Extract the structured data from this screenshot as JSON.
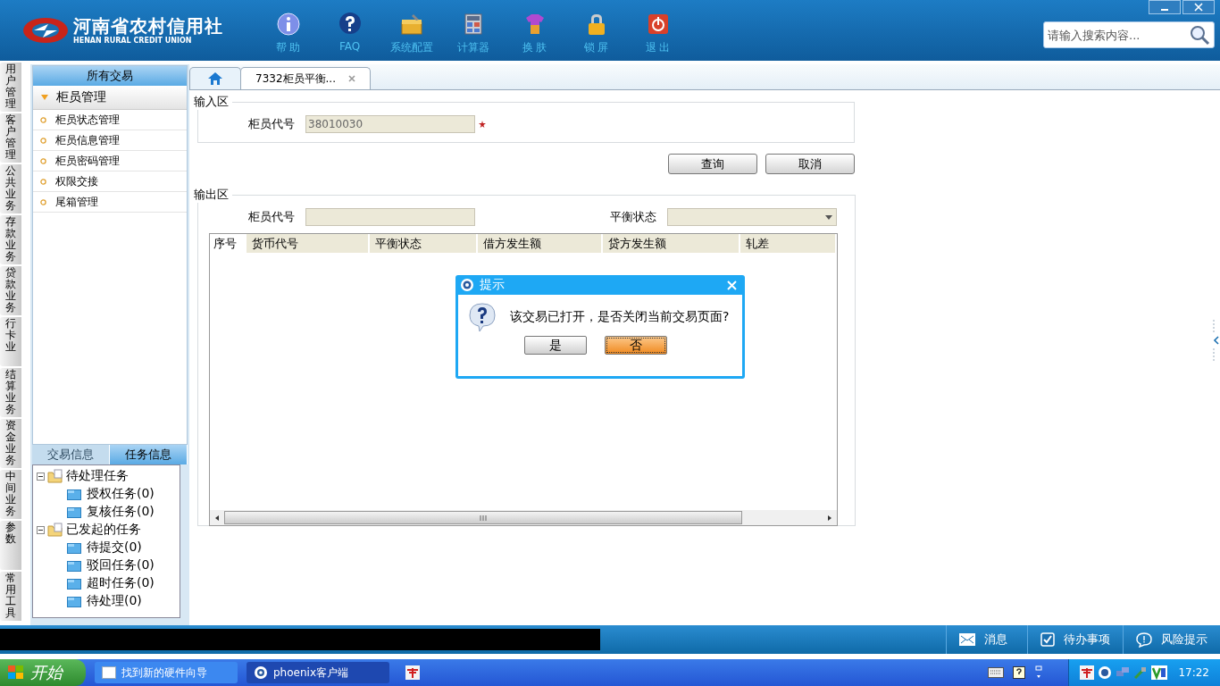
{
  "header": {
    "logo_title": "河南省农村信用社",
    "logo_subtitle": "HENAN RURAL CREDIT UNION",
    "toolbar": [
      {
        "label": "帮 助",
        "kind": "help"
      },
      {
        "label": "FAQ",
        "kind": "faq"
      },
      {
        "label": "系统配置",
        "kind": "config"
      },
      {
        "label": "计算器",
        "kind": "calculator"
      },
      {
        "label": "换 肤",
        "kind": "skin"
      },
      {
        "label": "锁 屏",
        "kind": "lock"
      },
      {
        "label": "退 出",
        "kind": "exit"
      }
    ],
    "search": {
      "placeholder": "请输入搜索内容..."
    }
  },
  "side_tabs": [
    "用户管理",
    "客户管理",
    "公共业务",
    "存款业务",
    "贷款业务",
    "行卡业",
    "结算业务",
    "资金业务",
    "中间业务",
    "参数",
    "常用工具"
  ],
  "menu": {
    "title": "所有交易",
    "group": "柜员管理",
    "expanded": true,
    "items": [
      "柜员状态管理",
      "柜员信息管理",
      "柜员密码管理",
      "权限交接",
      "尾箱管理"
    ]
  },
  "task_panel": {
    "tabs": [
      {
        "label": "交易信息",
        "selected": false
      },
      {
        "label": "任务信息",
        "selected": true
      }
    ],
    "tree": [
      {
        "label": "待处理任务",
        "expanded": true,
        "children": [
          {
            "label": "授权任务(0)"
          },
          {
            "label": "复核任务(0)"
          }
        ]
      },
      {
        "label": "已发起的任务",
        "expanded": true,
        "children": [
          {
            "label": "待提交(0)"
          },
          {
            "label": "驳回任务(0)"
          },
          {
            "label": "超时任务(0)"
          },
          {
            "label": "待处理(0)"
          }
        ]
      }
    ]
  },
  "tabs": [
    {
      "kind": "home",
      "selected": false
    },
    {
      "kind": "page",
      "label": "7332柜员平衡...",
      "selected": true
    }
  ],
  "input_section": {
    "title": "输入区",
    "label": "柜员代号",
    "value": "38010030",
    "required": true
  },
  "buttons": [
    "查询",
    "取消"
  ],
  "output_section": {
    "title": "输出区",
    "fields": [
      {
        "label": "柜员代号",
        "kind": "text"
      },
      {
        "label": "平衡状态",
        "kind": "select"
      }
    ],
    "columns": [
      "序号",
      "货币代号",
      "平衡状态",
      "借方发生额",
      "贷方发生额",
      "轧差"
    ]
  },
  "dialog": {
    "title": "提示",
    "message": "该交易已打开，是否关闭当前交易页面?",
    "buttons": [
      {
        "label": "是",
        "selected": false
      },
      {
        "label": "否",
        "selected": true
      }
    ]
  },
  "status_bar": [
    {
      "label": "消息",
      "kind": "message"
    },
    {
      "label": "待办事项",
      "kind": "todo"
    },
    {
      "label": "风险提示",
      "kind": "risk"
    }
  ],
  "taskbar": {
    "start": "开始",
    "windows": [
      {
        "label": "找到新的硬件向导",
        "kind": "window",
        "selected": false
      },
      {
        "label": "phoenix客户端",
        "kind": "browser",
        "selected": true
      },
      {
        "kind": "app"
      }
    ],
    "clock": "17:22"
  }
}
